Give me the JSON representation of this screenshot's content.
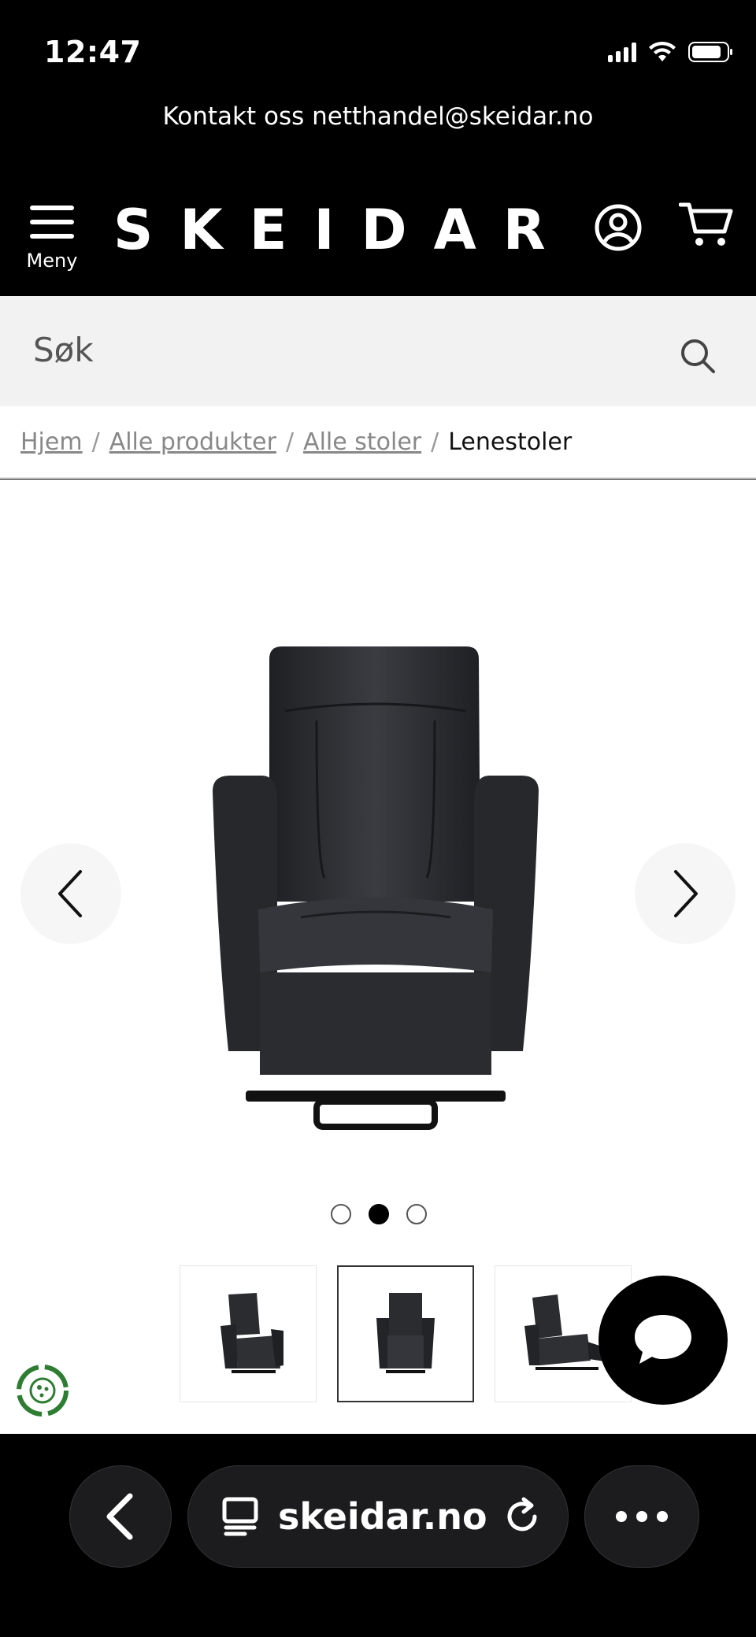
{
  "status_bar": {
    "time": "12:47"
  },
  "top_bar": {
    "contact_text": "Kontakt oss netthandel@skeidar.no"
  },
  "header": {
    "menu_label": "Meny",
    "logo": "SKEIDAR",
    "icons": [
      "account-icon",
      "cart-icon",
      "hamburger-icon"
    ]
  },
  "search": {
    "placeholder": "Søk"
  },
  "breadcrumb": {
    "items": [
      {
        "label": "Hjem"
      },
      {
        "label": "Alle produkter"
      },
      {
        "label": "Alle stoler"
      }
    ],
    "current": "Lenestoler"
  },
  "gallery": {
    "dots": 3,
    "active_index": 1,
    "thumbnails": 3,
    "selected_thumbnail": 1
  },
  "browser": {
    "url": "skeidar.no"
  },
  "colors": {
    "header_bg": "#000000",
    "search_bg": "#f2f2f2",
    "chair": "#2b2d31"
  }
}
